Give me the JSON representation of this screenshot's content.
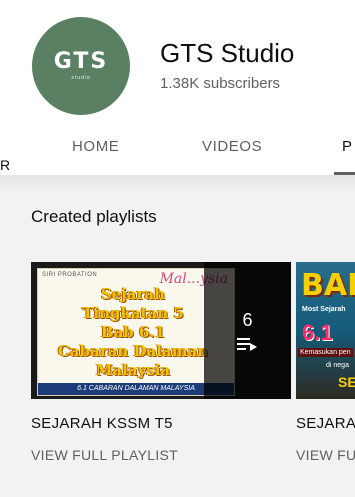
{
  "channel": {
    "avatar_logo": "GTS",
    "avatar_logo_sub": "studio",
    "name": "GTS Studio",
    "subscribers": "1.38K subscribers",
    "avatar_color": "#5b7f62"
  },
  "tabs": [
    {
      "label": "HOME"
    },
    {
      "label": "VIDEOS"
    },
    {
      "label": "P"
    }
  ],
  "edge_mark": "R",
  "section": {
    "title": "Created playlists"
  },
  "playlists": [
    {
      "title": "SEJARAH KSSM T5",
      "link": "VIEW FULL PLAYLIST",
      "video_count": "6",
      "thumb": {
        "top_text": "SIRI PROBATION",
        "deco": "Mal...ysia",
        "headline_lines": [
          "Sejarah",
          "Tingkatan 5",
          "Bab 6.1",
          "Cabaran Dalaman",
          "Malaysia"
        ],
        "strip": "6.1 CABARAN DALAMAN MALAYSIA"
      }
    },
    {
      "title": "SEJARA",
      "link": "VIEW FU",
      "thumb": {
        "headline": "BAB",
        "sub": "Most Sejarah",
        "number": "6.1",
        "line1": "Kemasukan pen",
        "line2": "di nega",
        "tail": "SE"
      }
    }
  ],
  "icons": {
    "queue": "playlist-queue-icon"
  }
}
